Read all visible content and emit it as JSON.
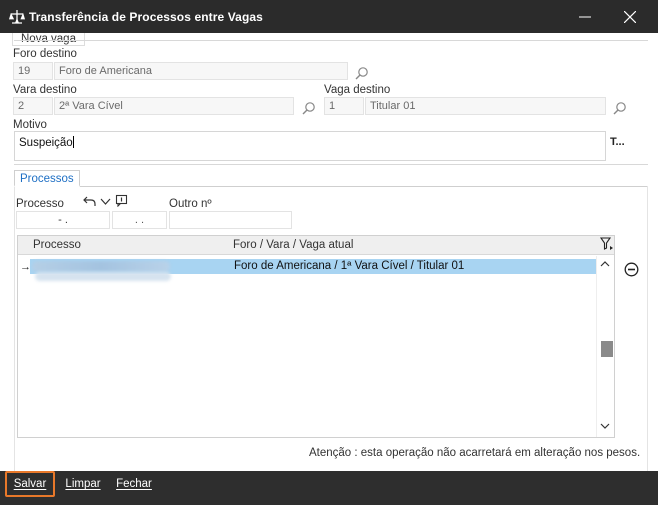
{
  "window": {
    "title": "Transferência de Processos entre Vagas",
    "minimize_icon": "minimize-icon",
    "close_icon": "close-icon",
    "app_icon": "scales-of-justice-icon"
  },
  "nova_vaga": {
    "section_label": "Nova vaga",
    "foro": {
      "label": "Foro destino",
      "code": "19",
      "name": "Foro de Americana"
    },
    "vara": {
      "label": "Vara destino",
      "code": "2",
      "name": "2ª Vara Cível"
    },
    "vaga": {
      "label": "Vaga destino",
      "code": "1",
      "name": "Titular 01"
    },
    "motivo": {
      "label": "Motivo",
      "value": "Suspeição",
      "more_label": "T..."
    }
  },
  "processos_tab": {
    "tab_label": "Processos",
    "processo_label": "Processo",
    "processo_part1": "- .",
    "processo_part2": ". .",
    "outro_label": "Outro nº",
    "grid": {
      "columns": [
        "Processo",
        "Foro / Vara / Vaga atual"
      ],
      "rows": [
        {
          "processo": "",
          "foro_vara_vaga": "Foro de Americana / 1ª Vara Cível / Titular 01",
          "selected": true
        }
      ],
      "filter_icon": "filter-icon",
      "row_pointer": "→",
      "scrollbar_position": 0.6
    },
    "notice": "Atenção : esta operação não acarretará em alteração nos pesos."
  },
  "footer": {
    "salvar": "Salvar",
    "limpar": "Limpar",
    "fechar": "Fechar"
  },
  "colors": {
    "titlebar": "#2b2b2b",
    "footer": "#2e2e2e",
    "selection": "#a8d4f2",
    "accent_tab": "#1e6fc4",
    "highlight": "#e8782a"
  }
}
